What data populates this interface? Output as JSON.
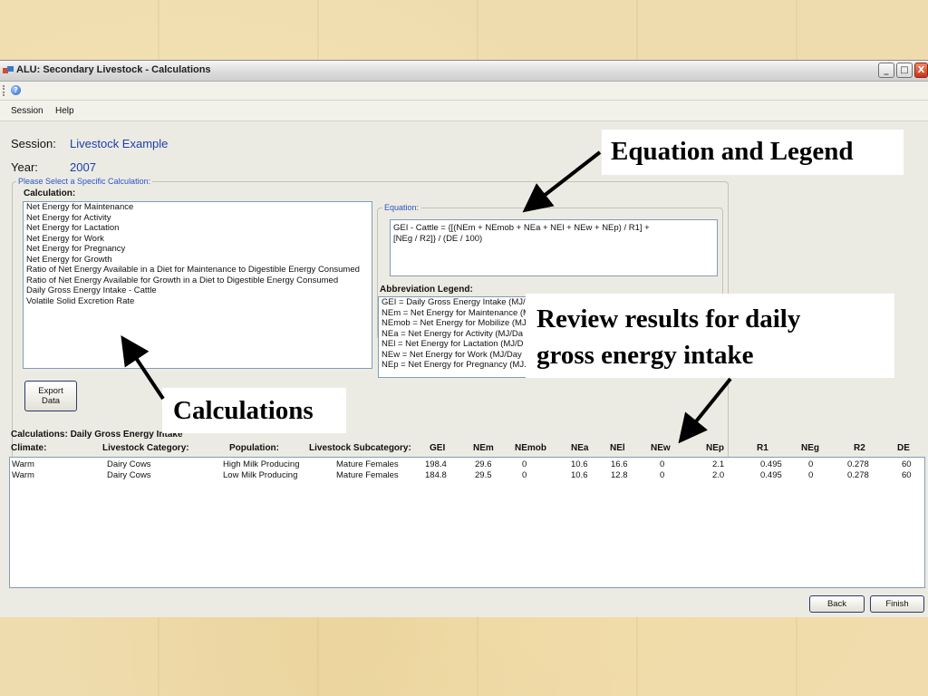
{
  "window": {
    "title": "ALU: Secondary Livestock - Calculations",
    "controls": {
      "minimize": "_",
      "maximize": "□",
      "close": "X"
    },
    "help_icon": "?"
  },
  "menu": {
    "items": [
      "Session",
      "Help"
    ]
  },
  "session": {
    "session_label": "Session:",
    "session_value": "Livestock Example",
    "year_label": "Year:",
    "year_value": "2007"
  },
  "selector": {
    "group_title": "Please Select a Specific Calculation:",
    "calculation_label": "Calculation:",
    "calculations": [
      "Net Energy for Maintenance",
      "Net Energy for Activity",
      "Net Energy for Lactation",
      "Net Energy for Work",
      "Net Energy for Pregnancy",
      "Net Energy for Growth",
      "Ratio of Net Energy Available in a Diet for Maintenance to Digestible Energy Consumed",
      "Ratio of Net Energy Available for Growth in a Diet to Digestible Energy Consumed",
      "Daily Gross Energy Intake - Cattle",
      "Volatile Solid Excretion Rate"
    ],
    "export_button": "Export Data"
  },
  "equation": {
    "group_title": "Equation:",
    "line1": "GEI - Cattle = {[(NEm + NEmob + NEa + NEl + NEw + NEp) / R1] +",
    "line2": "[NEg / R2]} / (DE / 100)"
  },
  "legend": {
    "title": "Abbreviation Legend:",
    "items": [
      "GEI = Daily Gross Energy Intake (MJ/",
      "NEm = Net Energy for Maintenance (M",
      "NEmob = Net Energy for Mobilize (MJ",
      "NEa = Net Energy for Activity (MJ/Da",
      "NEl = Net Energy for Lactation (MJ/D",
      "NEw = Net Energy for Work (MJ/Day",
      "NEp = Net Energy for Pregnancy (MJ."
    ]
  },
  "results": {
    "title": "Calculations: Daily Gross Energy Intake",
    "columns": [
      "Climate:",
      "Livestock Category:",
      "Population:",
      "Livestock Subcategory:",
      "GEI",
      "NEm",
      "NEmob",
      "NEa",
      "NEl",
      "NEw",
      "NEp",
      "R1",
      "NEg",
      "R2",
      "DE"
    ],
    "rows": [
      [
        "Warm",
        "Dairy Cows",
        "High Milk Producing",
        "Mature Females",
        "198.4",
        "29.6",
        "0",
        "10.6",
        "16.6",
        "0",
        "2.1",
        "0.495",
        "0",
        "0.278",
        "60"
      ],
      [
        "Warm",
        "Dairy Cows",
        "Low Milk Producing",
        "Mature Females",
        "184.8",
        "29.5",
        "0",
        "10.6",
        "12.8",
        "0",
        "2.0",
        "0.495",
        "0",
        "0.278",
        "60"
      ]
    ]
  },
  "footer": {
    "back": "Back",
    "finish": "Finish"
  },
  "callouts": {
    "equation_legend": "Equation and Legend",
    "review_line1": "Review results for daily",
    "review_line2": "gross energy intake",
    "calculations": "Calculations"
  },
  "colors": {
    "accent_blue": "#1c3fb0",
    "window_bg": "#ecebe3",
    "slide_bg": "#efdcae"
  },
  "icons": [
    "app-icon",
    "help-icon",
    "minimize-icon",
    "maximize-icon",
    "close-icon"
  ]
}
